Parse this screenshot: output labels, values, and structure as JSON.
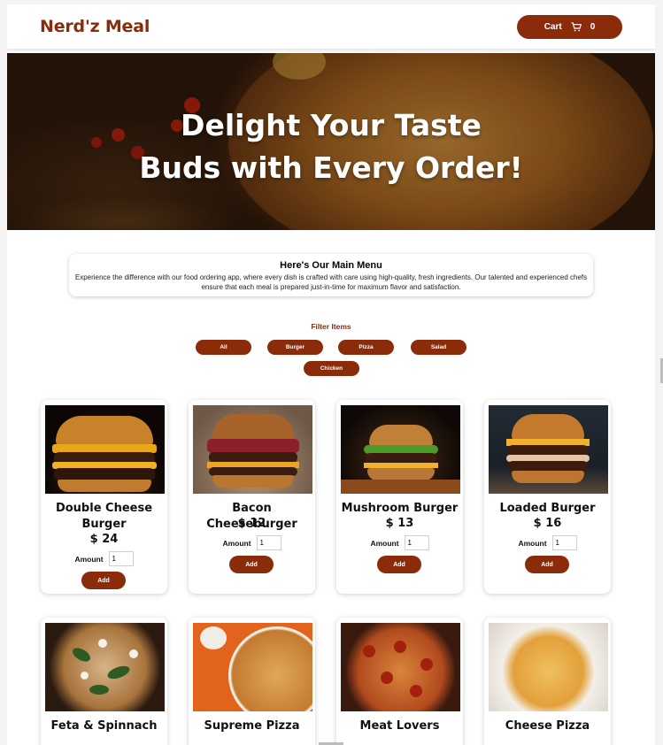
{
  "header": {
    "brand": "Nerd'z Meal",
    "cart_label": "Cart",
    "cart_count": "0"
  },
  "hero": {
    "line1": "Delight Your Taste",
    "line2": "Buds with Every Order!"
  },
  "intro": {
    "title": "Here's Our Main Menu",
    "text": "Experience the difference with our food ordering app, where every dish is crafted with care using high-quality, fresh ingredients. Our talented and experienced chefs ensure that each meal is prepared just-in-time for maximum flavor and satisfaction."
  },
  "filter": {
    "title": "Filter Items",
    "items": [
      "All",
      "Burger",
      "Pizza",
      "Salad",
      "Chicken"
    ]
  },
  "menu": [
    {
      "name": "Double Cheese Burger",
      "price": "$ 24",
      "amount_label": "Amount",
      "amount": "1",
      "add_label": "Add"
    },
    {
      "name": "Bacon Cheeseburger",
      "price": "$ 12",
      "amount_label": "Amount",
      "amount": "1",
      "add_label": "Add"
    },
    {
      "name": "Mushroom Burger",
      "price": "$ 13",
      "amount_label": "Amount",
      "amount": "1",
      "add_label": "Add"
    },
    {
      "name": "Loaded Burger",
      "price": "$ 16",
      "amount_label": "Amount",
      "amount": "1",
      "add_label": "Add"
    },
    {
      "name": "Feta & Spinnach"
    },
    {
      "name": "Supreme Pizza"
    },
    {
      "name": "Meat Lovers"
    },
    {
      "name": "Cheese Pizza"
    }
  ],
  "colors": {
    "accent": "#8a2b0a",
    "text": "#111111",
    "background": "#ffffff"
  }
}
